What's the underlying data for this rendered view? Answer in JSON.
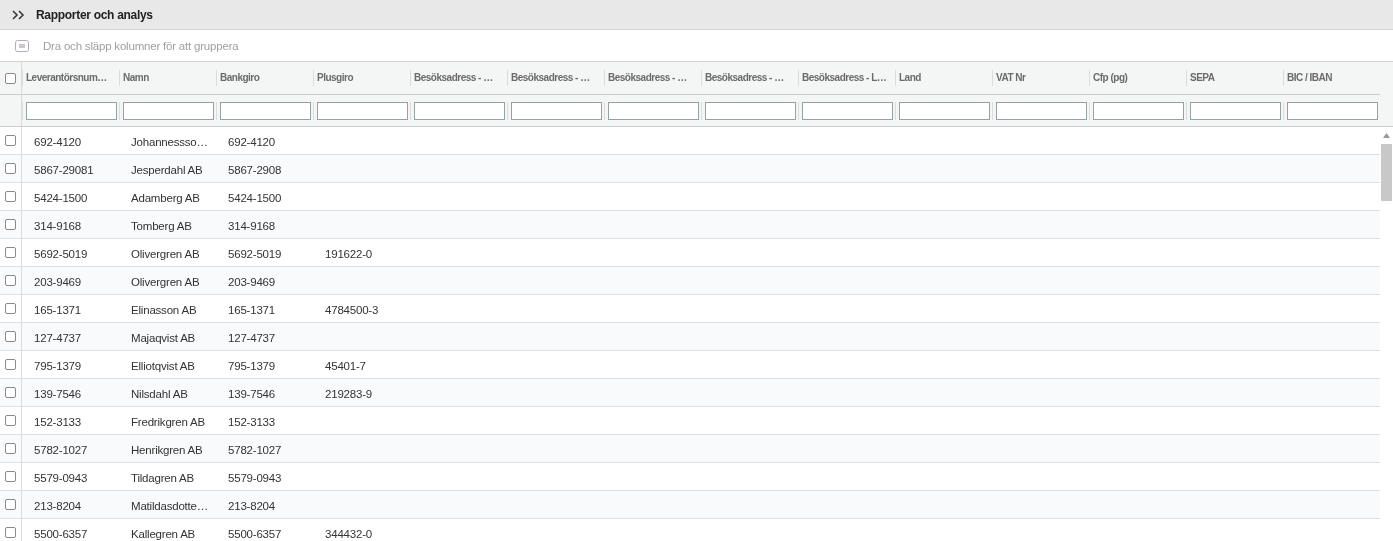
{
  "panel": {
    "title": "Rapporter och analys"
  },
  "group_panel": {
    "hint": "Dra och släpp kolumner för att gruppera"
  },
  "select_all": {
    "checked": false
  },
  "columns": [
    {
      "label": "Leverantörsnum…"
    },
    {
      "label": "Namn"
    },
    {
      "label": "Bankgiro"
    },
    {
      "label": "Plusgiro"
    },
    {
      "label": "Besöksadress - …"
    },
    {
      "label": "Besöksadress - …"
    },
    {
      "label": "Besöksadress - …"
    },
    {
      "label": "Besöksadress - …"
    },
    {
      "label": "Besöksadress - L…"
    },
    {
      "label": "Land"
    },
    {
      "label": "VAT Nr"
    },
    {
      "label": "Cfp (pg)"
    },
    {
      "label": "SEPA"
    },
    {
      "label": "BIC / IBAN"
    }
  ],
  "rows": [
    {
      "selected": false,
      "cells": [
        "692-4120",
        "Johannessso…",
        "692-4120"
      ]
    },
    {
      "selected": false,
      "cells": [
        "5867-29081",
        "Jesperdahl AB",
        "5867-2908"
      ]
    },
    {
      "selected": false,
      "cells": [
        "5424-1500",
        "Adamberg AB",
        "5424-1500"
      ]
    },
    {
      "selected": false,
      "cells": [
        "314-9168",
        "Tomberg AB",
        "314-9168"
      ]
    },
    {
      "selected": false,
      "cells": [
        "5692-5019",
        "Olivergren AB",
        "5692-5019",
        "191622-0"
      ]
    },
    {
      "selected": false,
      "cells": [
        "203-9469",
        "Olivergren AB",
        "203-9469"
      ]
    },
    {
      "selected": false,
      "cells": [
        "165-1371",
        "Elinasson AB",
        "165-1371",
        "4784500-3"
      ]
    },
    {
      "selected": false,
      "cells": [
        "127-4737",
        "Majaqvist AB",
        "127-4737"
      ]
    },
    {
      "selected": false,
      "cells": [
        "795-1379",
        "Elliotqvist AB",
        "795-1379",
        "45401-7"
      ]
    },
    {
      "selected": false,
      "cells": [
        "139-7546",
        "Nilsdahl AB",
        "139-7546",
        "219283-9"
      ]
    },
    {
      "selected": false,
      "cells": [
        "152-3133",
        "Fredrikgren AB",
        "152-3133"
      ]
    },
    {
      "selected": false,
      "cells": [
        "5782-1027",
        "Henrikgren AB",
        "5782-1027"
      ]
    },
    {
      "selected": false,
      "cells": [
        "5579-0943",
        "Tildagren AB",
        "5579-0943"
      ]
    },
    {
      "selected": false,
      "cells": [
        "213-8204",
        "Matildasdotte…",
        "213-8204"
      ]
    },
    {
      "selected": false,
      "cells": [
        "5500-6357",
        "Kallegren AB",
        "5500-6357",
        "344432-0"
      ]
    }
  ]
}
